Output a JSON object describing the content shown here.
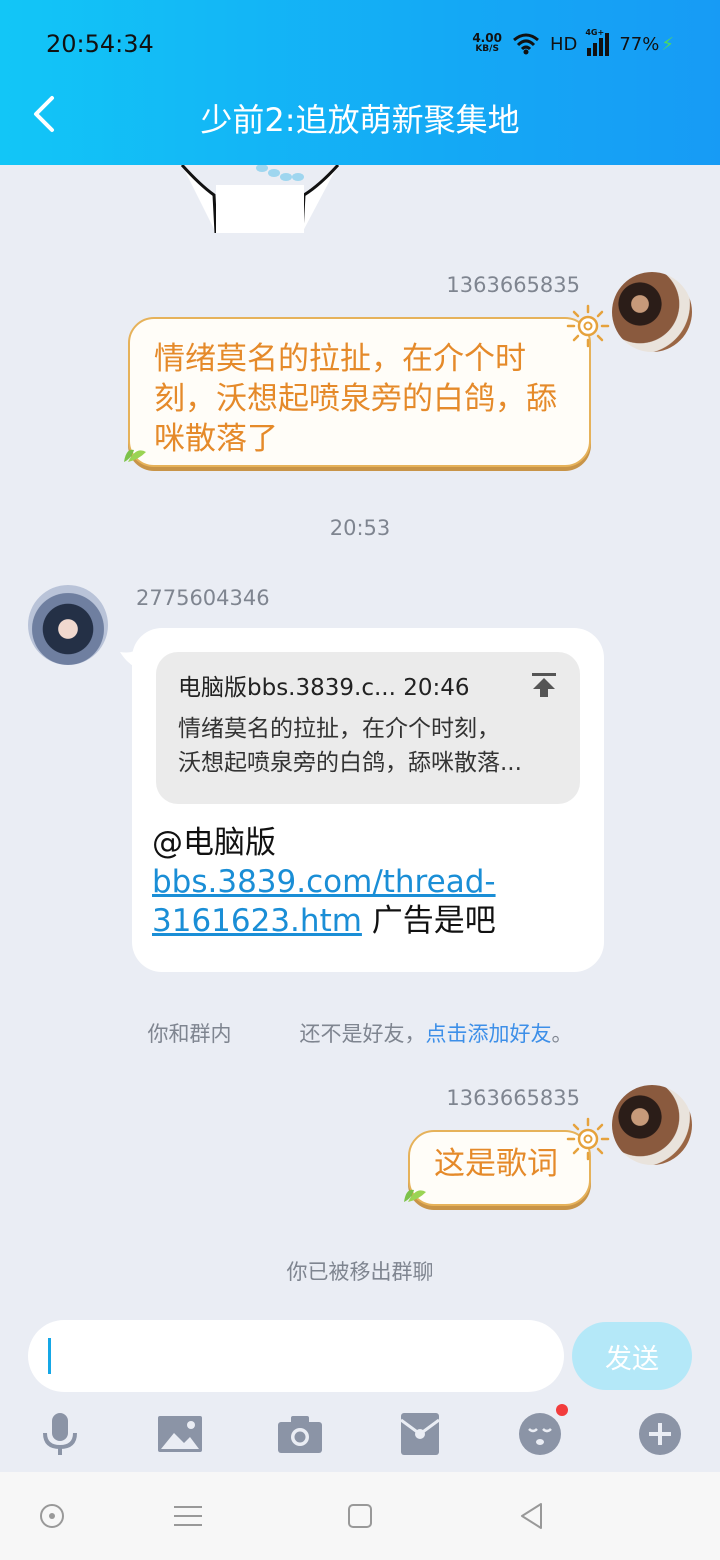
{
  "status_bar": {
    "time": "20:54:34",
    "net_speed": "4.00",
    "net_unit": "KB/S",
    "hd": "HD",
    "signal": "4G+",
    "battery": "77%"
  },
  "header": {
    "title": "少前2:追放萌新聚集地",
    "accent": "#14aaf5"
  },
  "messages": [
    {
      "sender": "1363665835",
      "text": "情绪莫名的拉扯，在介个时刻，沃想起喷泉旁的白鸽，舔咪散落了"
    },
    {
      "time": "20:53"
    },
    {
      "sender": "2775604346",
      "quote": {
        "source": "电脑版bbs.3839.c...",
        "time": "20:46",
        "line1": "情绪莫名的拉扯，在介个时刻，",
        "line2": "沃想起喷泉旁的白鸽，舔咪散落..."
      },
      "prefix": "@电脑版",
      "link": "bbs.3839.com/thread-3161623.htm",
      "suffix": " 广告是吧"
    },
    {
      "system": {
        "part1": "你和群内",
        "part2": "还不是好友，",
        "link": "点击添加好友",
        "end": "。"
      }
    },
    {
      "sender": "1363665835",
      "text": "这是歌词"
    },
    {
      "system_removed": "你已被移出群聊"
    }
  ],
  "input": {
    "value": "",
    "send_label": "发送"
  },
  "toolbar": {
    "icons": [
      "microphone-icon",
      "image-icon",
      "camera-icon",
      "red-packet-icon",
      "emoji-icon",
      "plus-icon"
    ]
  }
}
